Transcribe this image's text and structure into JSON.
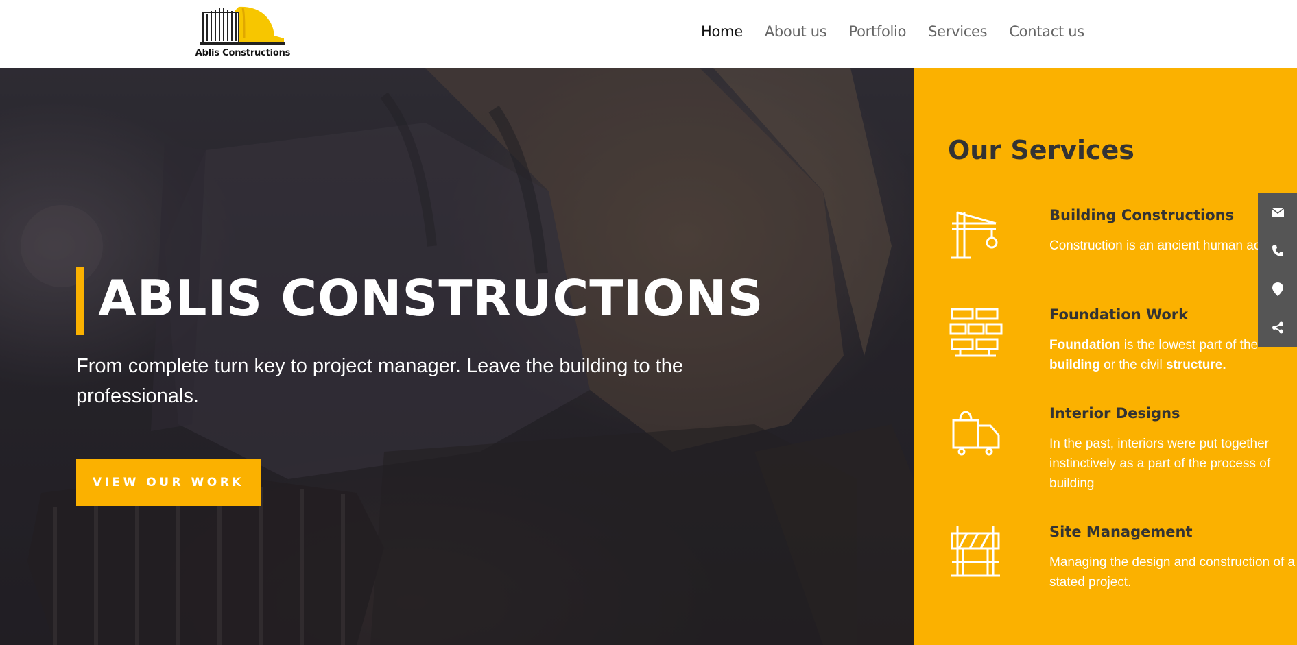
{
  "brand": {
    "name": "Ablis Constructions",
    "accent_color": "#fbb100",
    "logo_icon": "building-hardhat-logo"
  },
  "nav": {
    "items": [
      {
        "label": "Home",
        "active": true
      },
      {
        "label": "About us",
        "active": false
      },
      {
        "label": "Portfolio",
        "active": false
      },
      {
        "label": "Services",
        "active": false
      },
      {
        "label": "Contact us",
        "active": false
      }
    ]
  },
  "hero": {
    "title": "ABLIS CONSTRUCTIONS",
    "subtitle": "From complete turn key to project manager. Leave the building to the professionals.",
    "cta_label": "VIEW OUR WORK",
    "background": "excavator-photo"
  },
  "services": {
    "heading": "Our Services",
    "items": [
      {
        "icon": "crane-icon",
        "title": "Building Constructions",
        "desc": "Construction is an ancient human activity."
      },
      {
        "icon": "bricks-icon",
        "title": "Foundation Work",
        "desc_parts": {
          "b1": "Foundation",
          "t1": " is the lowest part of the ",
          "b2": "building",
          "t2": " or the civil ",
          "b3": "structure."
        }
      },
      {
        "icon": "interior-bag-icon",
        "title": "Interior Designs",
        "desc": "In the past, interiors were put together instinctively as a part of the process of building"
      },
      {
        "icon": "barrier-icon",
        "title": "Site Management",
        "desc": "Managing the design and construction of a stated project."
      }
    ]
  },
  "side_widget": {
    "buttons": [
      "envelope-icon",
      "phone-icon",
      "map-pin-icon",
      "share-icon"
    ],
    "color": "#555555"
  }
}
